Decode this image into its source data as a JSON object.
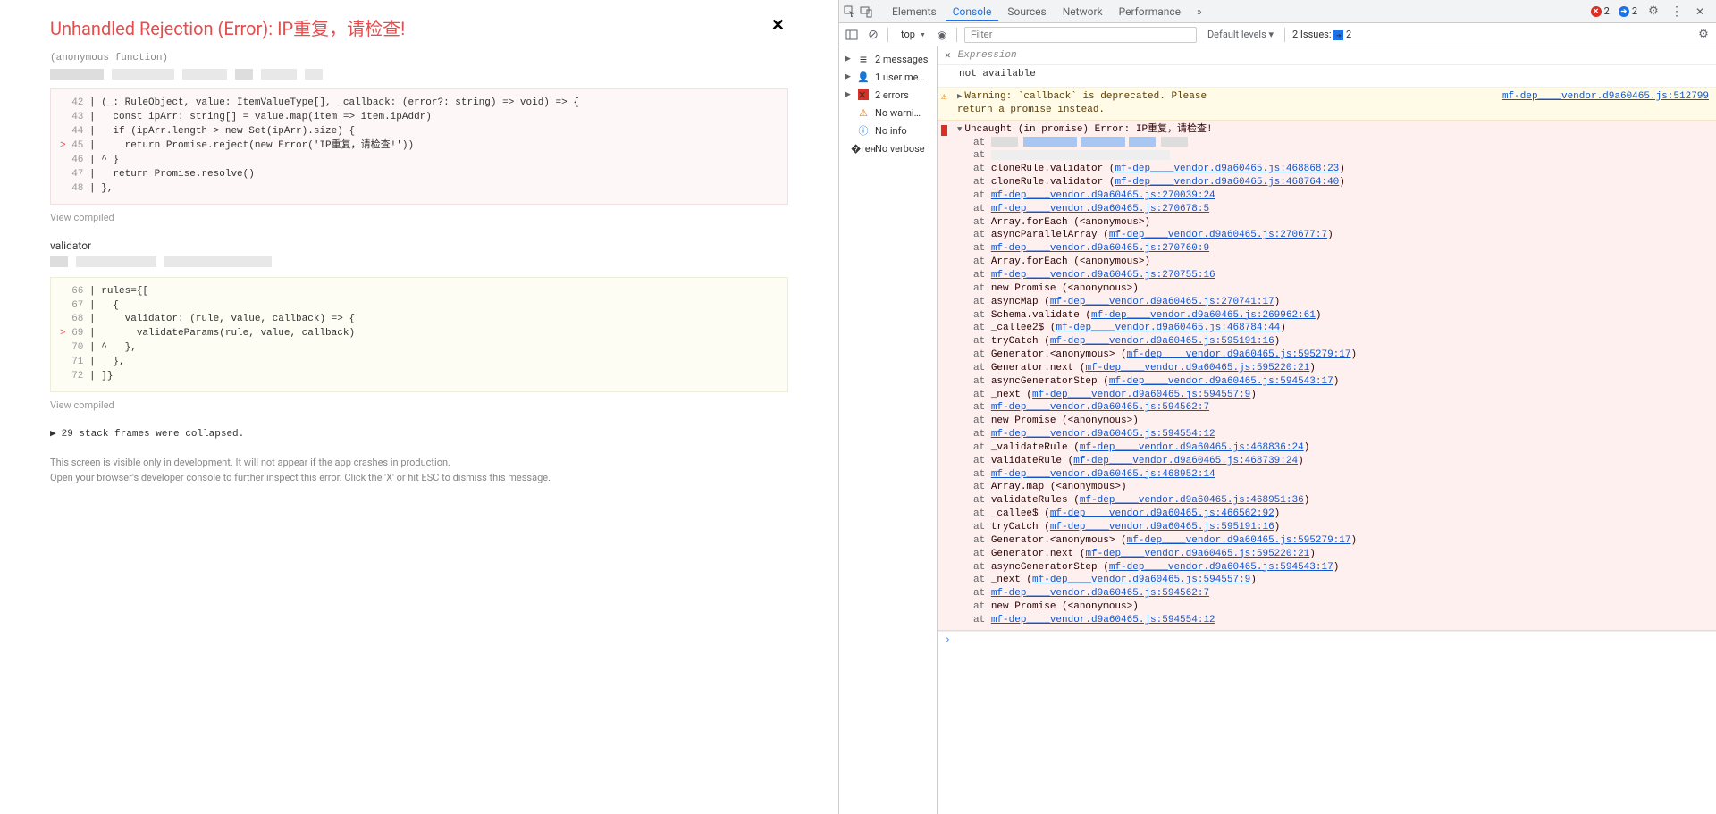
{
  "overlay": {
    "title": "Unhandled Rejection (Error): IP重复，请检查!",
    "close": "✕",
    "anon_func": "(anonymous function)",
    "code1_lines": [
      {
        "n": "42",
        "marker": "",
        "text": "| (_: RuleObject, value: ItemValueType[], _callback: (error?: string) => void) => {"
      },
      {
        "n": "43",
        "marker": "",
        "text": "|   const ipArr: string[] = value.map(item => item.ipAddr)"
      },
      {
        "n": "44",
        "marker": "",
        "text": "|   if (ipArr.length > new Set(ipArr).size) {"
      },
      {
        "n": "45",
        "marker": ">",
        "text": "|     return Promise.reject(new Error('IP重复，请检查!'))"
      },
      {
        "n": "46",
        "marker": "",
        "text": "| ^ }"
      },
      {
        "n": "47",
        "marker": "",
        "text": "|   return Promise.resolve()"
      },
      {
        "n": "48",
        "marker": "",
        "text": "| },"
      }
    ],
    "view_compiled": "View compiled",
    "validator_label": "validator",
    "code2_lines": [
      {
        "n": "66",
        "marker": "",
        "text": "| rules={["
      },
      {
        "n": "67",
        "marker": "",
        "text": "|   {"
      },
      {
        "n": "68",
        "marker": "",
        "text": "|     validator: (rule, value, callback) => {"
      },
      {
        "n": "69",
        "marker": ">",
        "text": "|       validateParams(rule, value, callback)"
      },
      {
        "n": "70",
        "marker": "",
        "text": "| ^   },"
      },
      {
        "n": "71",
        "marker": "",
        "text": "|   },"
      },
      {
        "n": "72",
        "marker": "",
        "text": "| ]}"
      }
    ],
    "collapsed": "29 stack frames were collapsed.",
    "collapsed_arrow": "▶",
    "footer1": "This screen is visible only in development. It will not appear if the app crashes in production.",
    "footer2": "Open your browser's developer console to further inspect this error.  Click the 'X' or hit ESC to dismiss this message."
  },
  "devtools": {
    "tabs": {
      "elements": "Elements",
      "console": "Console",
      "sources": "Sources",
      "network": "Network",
      "performance": "Performance",
      "more": "»"
    },
    "status": {
      "errors": "2",
      "msgs": "2",
      "issues_label": "2 Issues:",
      "issues_count": "2"
    },
    "toolbar": {
      "context": "top",
      "filter_placeholder": "Filter",
      "levels": "Default levels"
    },
    "sidebar": {
      "messages": "2 messages",
      "user": "1 user me…",
      "errors": "2 errors",
      "warnings": "No warni…",
      "info": "No info",
      "verbose": "No verbose"
    },
    "expr": {
      "placeholder": "Expression",
      "not_available": "not available"
    },
    "warn": {
      "text_a": "Warning: `callback` is deprecated. Please ",
      "text_b": "return a promise instead.",
      "src": "mf-dep____vendor.d9a60465.js:512799"
    },
    "err": {
      "head": "Uncaught (in promise) Error: IP重复，请检查!",
      "at": "at",
      "vendor_prefix": "mf-dep____vendor.d9a60465.js:",
      "stack": [
        {
          "t": "redact1"
        },
        {
          "t": "redact2"
        },
        {
          "t": "fn",
          "fn": "cloneRule.validator",
          "loc": "468868:23",
          "wrap": true
        },
        {
          "t": "fn",
          "fn": "cloneRule.validator",
          "loc": "468764:40",
          "wrap": true
        },
        {
          "t": "link",
          "loc": "270039:24"
        },
        {
          "t": "link",
          "loc": "270678:5"
        },
        {
          "t": "plain",
          "fn": "Array.forEach (<anonymous>)"
        },
        {
          "t": "fn",
          "fn": "asyncParallelArray",
          "loc": "270677:7",
          "wrap": true
        },
        {
          "t": "link",
          "loc": "270760:9"
        },
        {
          "t": "plain",
          "fn": "Array.forEach (<anonymous>)"
        },
        {
          "t": "link",
          "loc": "270755:16"
        },
        {
          "t": "plain",
          "fn": "new Promise (<anonymous>)"
        },
        {
          "t": "fn",
          "fn": "asyncMap",
          "loc": "270741:17",
          "wrap": true
        },
        {
          "t": "fn",
          "fn": "Schema.validate",
          "loc": "269962:61",
          "wrap": true
        },
        {
          "t": "fn",
          "fn": "_callee2$",
          "loc": "468784:44",
          "wrap": true
        },
        {
          "t": "fn",
          "fn": "tryCatch",
          "loc": "595191:16",
          "wrap": true
        },
        {
          "t": "fn",
          "fn": "Generator.<anonymous>",
          "loc": "595279:17",
          "wrap": true
        },
        {
          "t": "fn",
          "fn": "Generator.next",
          "loc": "595220:21",
          "wrap": true
        },
        {
          "t": "fn",
          "fn": "asyncGeneratorStep",
          "loc": "594543:17",
          "wrap": true
        },
        {
          "t": "fn",
          "fn": "_next",
          "loc": "594557:9",
          "wrap": true
        },
        {
          "t": "link",
          "loc": "594562:7"
        },
        {
          "t": "plain",
          "fn": "new Promise (<anonymous>)"
        },
        {
          "t": "link",
          "loc": "594554:12"
        },
        {
          "t": "fn",
          "fn": "_validateRule",
          "loc": "468836:24",
          "wrap": true
        },
        {
          "t": "fn",
          "fn": "validateRule",
          "loc": "468739:24",
          "wrap": true
        },
        {
          "t": "link",
          "loc": "468952:14"
        },
        {
          "t": "plain",
          "fn": "Array.map (<anonymous>)"
        },
        {
          "t": "fn",
          "fn": "validateRules",
          "loc": "468951:36",
          "wrap": true
        },
        {
          "t": "fn",
          "fn": "_callee$",
          "loc": "466562:92",
          "wrap": true
        },
        {
          "t": "fn",
          "fn": "tryCatch",
          "loc": "595191:16",
          "wrap": true
        },
        {
          "t": "fn",
          "fn": "Generator.<anonymous>",
          "loc": "595279:17",
          "wrap": true
        },
        {
          "t": "fn",
          "fn": "Generator.next",
          "loc": "595220:21",
          "wrap": true
        },
        {
          "t": "fn",
          "fn": "asyncGeneratorStep",
          "loc": "594543:17",
          "wrap": true
        },
        {
          "t": "fn",
          "fn": "_next",
          "loc": "594557:9",
          "wrap": true
        },
        {
          "t": "link",
          "loc": "594562:7"
        },
        {
          "t": "plain",
          "fn": "new Promise (<anonymous>)"
        },
        {
          "t": "link",
          "loc": "594554:12"
        }
      ]
    },
    "prompt": "›"
  }
}
